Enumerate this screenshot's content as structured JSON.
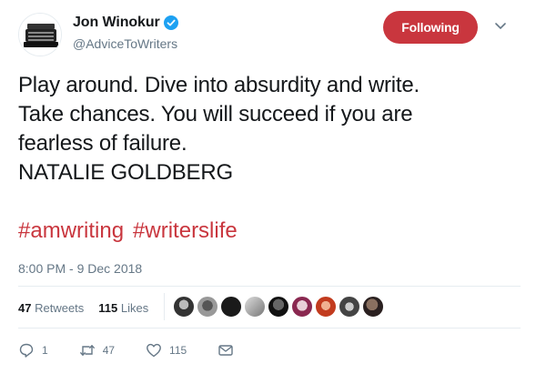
{
  "header": {
    "display_name": "Jon Winokur",
    "handle": "@AdviceToWriters",
    "follow_label": "Following"
  },
  "tweet": {
    "lines": [
      "Play around. Dive into absurdity and write.",
      "Take chances. You will succeed if you are",
      "fearless of failure.",
      "NATALIE GOLDBERG"
    ],
    "hashtags": [
      "#amwriting",
      "#writerslife"
    ],
    "timestamp": "8:00 PM - 9 Dec 2018"
  },
  "stats": {
    "retweets_count": "47",
    "retweets_label": "Retweets",
    "likes_count": "115",
    "likes_label": "Likes"
  },
  "actions": {
    "reply_count": "1",
    "retweet_count": "47",
    "like_count": "115"
  },
  "colors": {
    "accent": "#c9363e",
    "verified": "#1da1f2",
    "muted": "#657786"
  }
}
